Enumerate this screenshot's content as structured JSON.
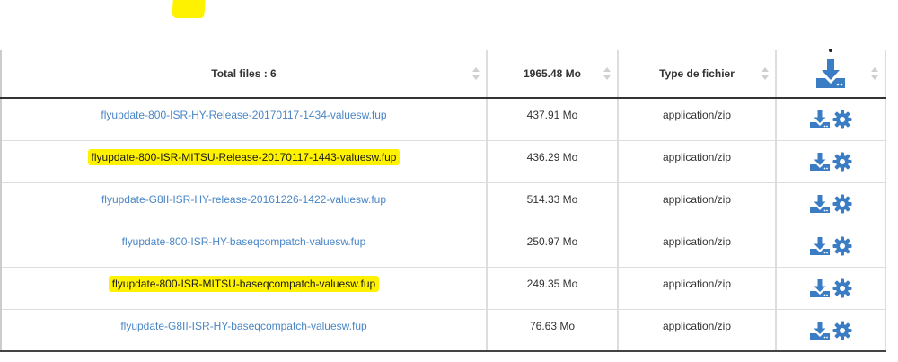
{
  "header": {
    "total_files": "Total files : 6",
    "total_size": "1965.48 Mo",
    "type_col": "Type de fichier",
    "download_all_icon": "download-icon"
  },
  "rows": [
    {
      "name": "flyupdate-800-ISR-HY-Release-20170117-1434-valuesw.fup",
      "size": "437.91 Mo",
      "type": "application/zip",
      "highlighted": false
    },
    {
      "name": "flyupdate-800-ISR-MITSU-Release-20170117-1443-valuesw.fup",
      "size": "436.29 Mo",
      "type": "application/zip",
      "highlighted": true
    },
    {
      "name": "flyupdate-G8II-ISR-HY-release-20161226-1422-valuesw.fup",
      "size": "514.33 Mo",
      "type": "application/zip",
      "highlighted": false
    },
    {
      "name": "flyupdate-800-ISR-HY-baseqcompatch-valuesw.fup",
      "size": "250.97 Mo",
      "type": "application/zip",
      "highlighted": false
    },
    {
      "name": "flyupdate-800-ISR-MITSU-baseqcompatch-valuesw.fup",
      "size": "249.35 Mo",
      "type": "application/zip",
      "highlighted": true
    },
    {
      "name": "flyupdate-G8II-ISR-HY-baseqcompatch-valuesw.fup",
      "size": "76.63 Mo",
      "type": "application/zip",
      "highlighted": false
    }
  ],
  "colors": {
    "link": "#4a86c5",
    "icon": "#3b7dc4",
    "highlight": "#fff200"
  },
  "icons": {
    "download": "download-icon",
    "settings": "gear-icon",
    "sort": "sort-icon"
  }
}
